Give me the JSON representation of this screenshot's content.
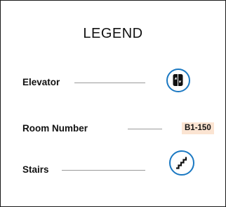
{
  "legend": {
    "title": "LEGEND",
    "items": [
      {
        "label": "Elevator",
        "icon": "elevator-icon",
        "icon_color": "#1a78c2"
      },
      {
        "label": "Room Number",
        "sample": "B1-150",
        "sample_background": "#fbe4d2"
      },
      {
        "label": "Stairs",
        "icon": "stairs-icon",
        "icon_color": "#1a78c2"
      }
    ]
  }
}
